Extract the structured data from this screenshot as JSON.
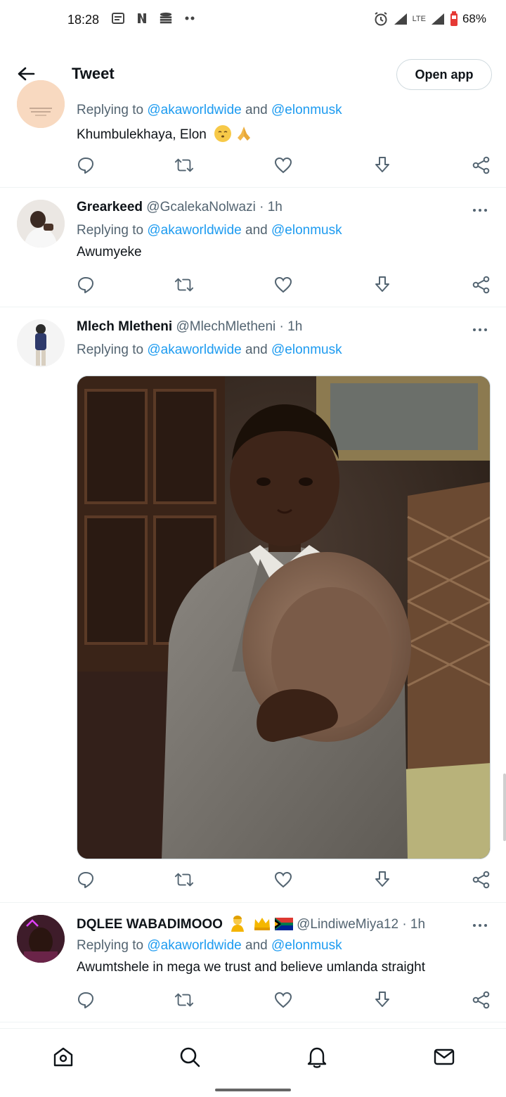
{
  "status_bar": {
    "time": "18:28",
    "left_icons": [
      "news-icon",
      "netflix-icon",
      "stack-icon",
      "more-dots-icon"
    ],
    "right_icons": [
      "alarm-icon",
      "signal-icon",
      "lte-icon",
      "signal-icon-2",
      "battery-icon"
    ],
    "network": "LTE",
    "battery": "68%"
  },
  "header": {
    "title": "Tweet",
    "open_app_label": "Open app"
  },
  "tweets": [
    {
      "reply_prefix": "Replying to ",
      "mention_1": "@akaworldwide",
      "reply_and": " and ",
      "mention_2": "@elonmusk",
      "text": "Khumbulekhaya, Elon",
      "emojis": [
        "face-emoji",
        "folded-hands-emoji"
      ]
    },
    {
      "name": "Grearkeed",
      "handle": "@GcalekaNolwazi",
      "time": "· 1h",
      "reply_prefix": "Replying to ",
      "mention_1": "@akaworldwide",
      "reply_and": " and ",
      "mention_2": "@elonmusk",
      "text": "Awumyeke"
    },
    {
      "name": "Mlech Mletheni",
      "handle": "@MlechMletheni",
      "time": "· 1h",
      "reply_prefix": "Replying to ",
      "mention_1": "@akaworldwide",
      "reply_and": " and ",
      "mention_2": "@elonmusk",
      "media": "photo"
    },
    {
      "name": "DQLEE WABADIMOOO",
      "handle": "@LindiweMiya12",
      "time": "· 1h",
      "reply_prefix": "Replying to ",
      "mention_1": "@akaworldwide",
      "reply_and": " and ",
      "mention_2": "@elonmusk",
      "text": "Awumtshele in mega we trust and believe umlanda straight"
    }
  ],
  "action_icons": [
    "reply-icon",
    "retweet-icon",
    "like-icon",
    "save-icon",
    "share-icon"
  ],
  "bottom_nav": [
    "home-icon",
    "search-icon",
    "notifications-icon",
    "messages-icon"
  ],
  "colors": {
    "accent": "#1d9bf0",
    "secondary_text": "#536471",
    "primary_text": "#0f1419",
    "divider": "#eff3f4"
  }
}
